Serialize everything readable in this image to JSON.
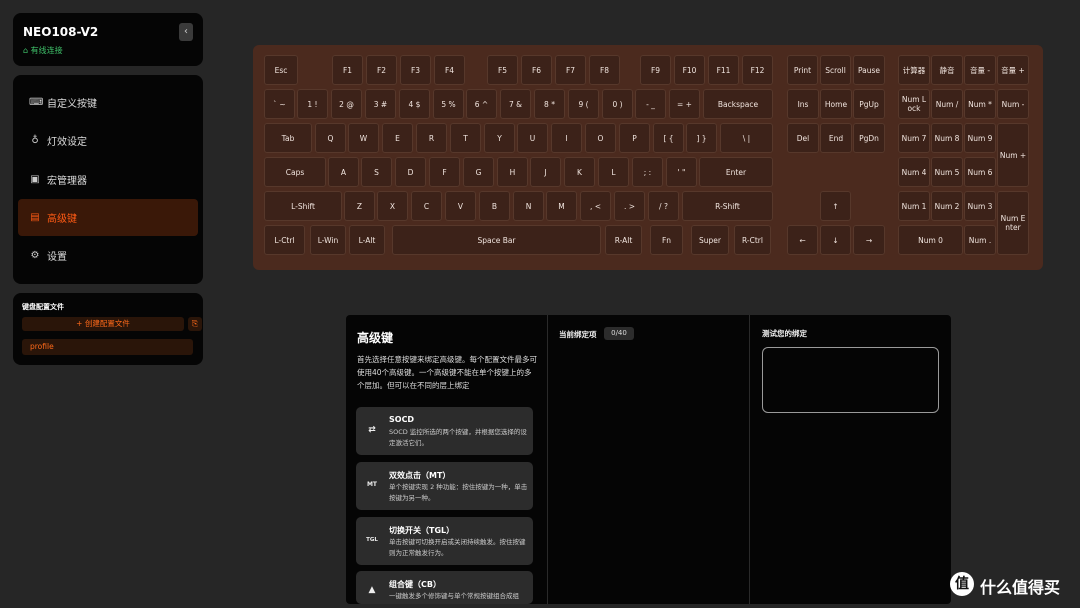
{
  "device": {
    "name": "NEO108-V2",
    "status": "有线连接",
    "status_icon": "usb-plug-icon",
    "back_icon": "chevron-left-icon"
  },
  "nav": {
    "items": [
      {
        "label": "自定义按键",
        "icon": "keyboard-icon",
        "active": false
      },
      {
        "label": "灯效设定",
        "icon": "bulb-icon",
        "active": false
      },
      {
        "label": "宏管理器",
        "icon": "macro-icon",
        "active": false
      },
      {
        "label": "高级键",
        "icon": "advanced-key-icon",
        "active": true
      },
      {
        "label": "设置",
        "icon": "gear-icon",
        "active": false
      }
    ]
  },
  "profiles": {
    "title": "键盘配置文件",
    "create_label": "+ 创建配置文件",
    "import_icon": "import-file-icon",
    "items": [
      "profile"
    ]
  },
  "keyboard": {
    "colors": {
      "case": "#4b2a1e",
      "key": "#3c2219",
      "legend": "#f1e5df"
    },
    "keys": [
      "Esc",
      "F1",
      "F2",
      "F3",
      "F4",
      "F5",
      "F6",
      "F7",
      "F8",
      "F9",
      "F10",
      "F11",
      "F12",
      "Print",
      "Scroll",
      "Pause",
      "计算器",
      "静音",
      "音量 -",
      "音量 +",
      "` ~",
      "1 !",
      "2 @",
      "3 #",
      "4 $",
      "5 %",
      "6 ^",
      "7 &",
      "8 *",
      "9 (",
      "0 )",
      "- _",
      "= +",
      "Backspace",
      "Ins",
      "Home",
      "PgUp",
      "Num Lock",
      "Num /",
      "Num *",
      "Num -",
      "Tab",
      "Q",
      "W",
      "E",
      "R",
      "T",
      "Y",
      "U",
      "I",
      "O",
      "P",
      "[ {",
      "] }",
      "\\ |",
      "Del",
      "End",
      "PgDn",
      "Num 7",
      "Num 8",
      "Num 9",
      "Num +",
      "Caps",
      "A",
      "S",
      "D",
      "F",
      "G",
      "H",
      "J",
      "K",
      "L",
      "; :",
      "' \"",
      "Enter",
      "Num 4",
      "Num 5",
      "Num 6",
      "L-Shift",
      "Z",
      "X",
      "C",
      "V",
      "B",
      "N",
      "M",
      ", <",
      ". >",
      "/ ?",
      "R-Shift",
      "↑",
      "Num 1",
      "Num 2",
      "Num 3",
      "Num Enter",
      "L-Ctrl",
      "L-Win",
      "L-Alt",
      "Space Bar",
      "R-Alt",
      "Fn",
      "Super",
      "R-Ctrl",
      "←",
      "↓",
      "→",
      "Num 0",
      "Num ."
    ]
  },
  "advanced": {
    "title": "高级键",
    "description": "首先选择任意按键来绑定高级键。每个配置文件最多可使用40个高级键。一个高级键不能在单个按键上的多个层加。但可以在不同的层上绑定",
    "modes": [
      {
        "title": "SOCD",
        "desc": "SOCD 监控所选的两个按键，并根据您选择的设定激活它们。",
        "icon": "socd-icon",
        "glyph": "⇄"
      },
      {
        "title": "双效点击（MT）",
        "desc": "单个按键实现 2 种功能：按住按键为一种，单击按键为另一种。",
        "icon": "mt-icon",
        "glyph": "MT"
      },
      {
        "title": "切换开关（TGL）",
        "desc": "单击按键可切换开启或关闭持续触发。按住按键则为正常触发行为。",
        "icon": "tgl-icon",
        "glyph": "TGL"
      },
      {
        "title": "组合键（CB）",
        "desc": "一键触发多个修饰键与单个常规按键组合成组",
        "icon": "cb-icon",
        "glyph": "▲"
      }
    ],
    "bindings_label": "当前绑定项",
    "bindings_count": "0/40",
    "test_label": "测试您的绑定"
  },
  "watermark": {
    "logo_char": "值",
    "text": "什么值得买",
    "icon": "smzdm-logo-icon"
  },
  "accent": "#ff5a14"
}
